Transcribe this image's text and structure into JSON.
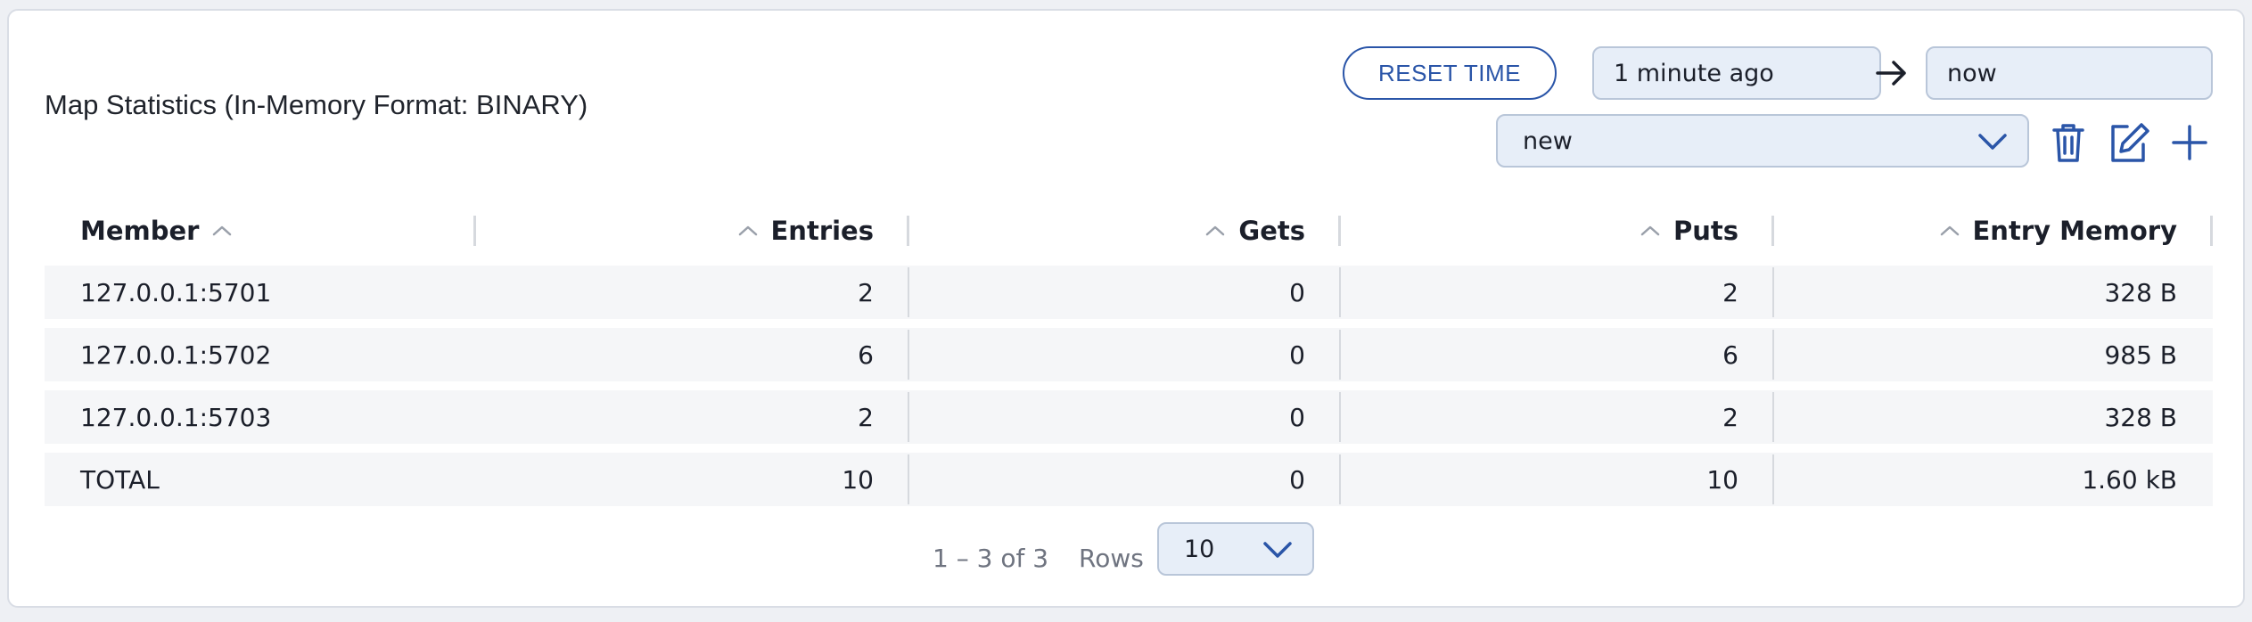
{
  "panel": {
    "title": "Map Statistics (In-Memory Format: BINARY)"
  },
  "time_range": {
    "reset_label": "RESET TIME",
    "from": "1 minute ago",
    "to": "now"
  },
  "view_select": {
    "value": "new"
  },
  "table": {
    "columns": [
      "Member",
      "Entries",
      "Gets",
      "Puts",
      "Entry Memory"
    ],
    "rows": [
      [
        "127.0.0.1:5701",
        "2",
        "0",
        "2",
        "328 B"
      ],
      [
        "127.0.0.1:5702",
        "6",
        "0",
        "6",
        "985 B"
      ],
      [
        "127.0.0.1:5703",
        "2",
        "0",
        "2",
        "328 B"
      ],
      [
        "TOTAL",
        "10",
        "0",
        "10",
        "1.60 kB"
      ]
    ]
  },
  "pagination": {
    "range": "1 – 3 of 3",
    "rows_label": "Rows",
    "rows_value": "10"
  },
  "colors": {
    "accent": "#2a55a8",
    "input_bg": "#e7eef8",
    "row_bg": "#f5f6f8"
  }
}
